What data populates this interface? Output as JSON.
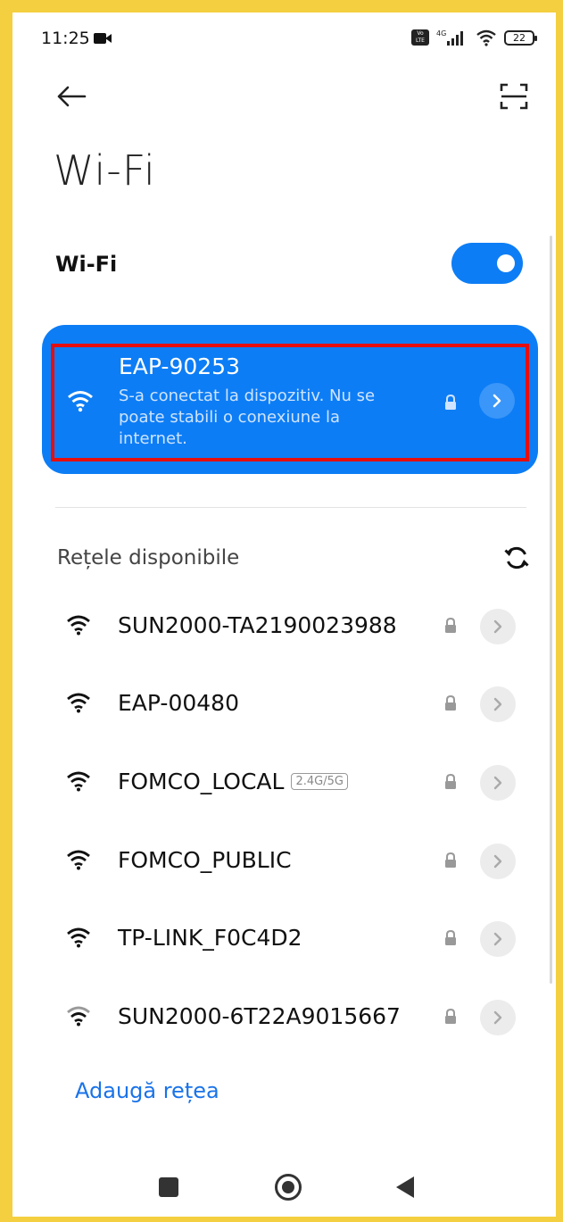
{
  "status_bar": {
    "time": "11:25",
    "network_type": "4G",
    "volte_label": "Vo LTE",
    "battery": "22"
  },
  "header": {
    "title": "Wi-Fi"
  },
  "wifi_toggle": {
    "label": "Wi-Fi",
    "enabled": true
  },
  "connected": {
    "name": "EAP-90253",
    "status": "S-a conectat la dispozitiv. Nu se poate stabili o conexiune la internet.",
    "secured": true
  },
  "available": {
    "header": "Rețele disponibile",
    "networks": [
      {
        "name": "SUN2000-TA2190023988",
        "badge": "",
        "secured": true
      },
      {
        "name": "EAP-00480",
        "badge": "",
        "secured": true
      },
      {
        "name": "FOMCO_LOCAL",
        "badge": "2.4G/5G",
        "secured": true
      },
      {
        "name": "FOMCO_PUBLIC",
        "badge": "",
        "secured": true
      },
      {
        "name": "TP-LINK_F0C4D2",
        "badge": "",
        "secured": true
      },
      {
        "name": "SUN2000-6T22A9015667",
        "badge": "",
        "secured": true
      }
    ]
  },
  "add_network": "Adaugă rețea",
  "colors": {
    "accent": "#0d7df5",
    "highlight": "#e50e0e",
    "frame": "#f4cf3f",
    "link": "#1a73e8"
  }
}
